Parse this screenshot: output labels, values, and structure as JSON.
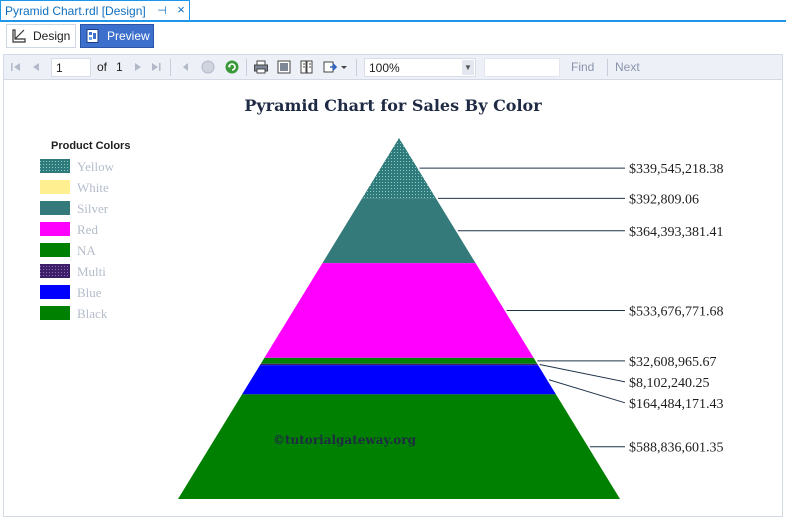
{
  "window": {
    "tab_title": "Pyramid Chart.rdl [Design]",
    "pin_glyph": "⊣",
    "close_glyph": "×"
  },
  "view_tabs": {
    "design_label": "Design",
    "preview_label": "Preview",
    "active": "Preview"
  },
  "toolbar": {
    "page_value": "1",
    "of_label": "of",
    "total_pages": "1",
    "zoom_value": "100%",
    "find_placeholder": "",
    "find_label": "Find",
    "next_label": "Next"
  },
  "watermark": "©tutorialgateway.org",
  "chart_data": {
    "type": "pyramid",
    "title": "Pyramid Chart for Sales By Color",
    "legend": {
      "title": "Product Colors",
      "position": "left"
    },
    "order_top_to_bottom": [
      "Yellow",
      "White",
      "Silver",
      "Red",
      "NA",
      "Multi",
      "Blue",
      "Black"
    ],
    "series": [
      {
        "name": "Yellow",
        "value": 339545218.38,
        "label": "$339,545,218.38",
        "color": "#3a8585",
        "pattern": "dots"
      },
      {
        "name": "White",
        "value": 392809.06,
        "label": "$392,809.06",
        "color": "#ffef90",
        "pattern": "none"
      },
      {
        "name": "Silver",
        "value": 364393381.41,
        "label": "$364,393,381.41",
        "color": "#347a7a",
        "pattern": "none"
      },
      {
        "name": "Red",
        "value": 533676771.68,
        "label": "$533,676,771.68",
        "color": "#ff00ff",
        "pattern": "none"
      },
      {
        "name": "NA",
        "value": 32608965.67,
        "label": "$32,608,965.67",
        "color": "#008000",
        "pattern": "none"
      },
      {
        "name": "Multi",
        "value": 8102240.25,
        "label": "$8,102,240.25",
        "color": "#4b2a7b",
        "pattern": "dots"
      },
      {
        "name": "Blue",
        "value": 164484171.43,
        "label": "$164,484,171.43",
        "color": "#0000ff",
        "pattern": "none"
      },
      {
        "name": "Black",
        "value": 588836601.35,
        "label": "$588,836,601.35",
        "color": "#008000",
        "pattern": "none"
      }
    ]
  }
}
